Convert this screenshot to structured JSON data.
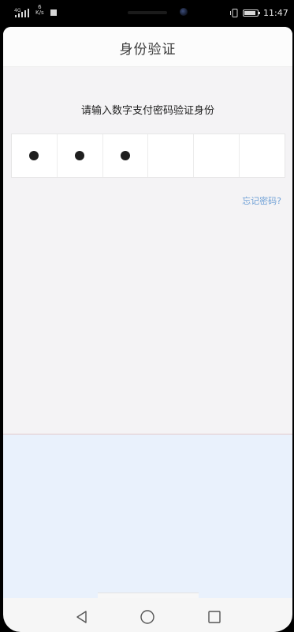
{
  "status_bar": {
    "network_label": "4G",
    "speed_value": "6",
    "speed_unit": "K/s",
    "time": "11:47",
    "battery_percent": 85
  },
  "header": {
    "title": "身份验证"
  },
  "main": {
    "prompt": "请输入数字支付密码验证身份",
    "pin": {
      "length": 6,
      "filled": 3
    },
    "forgot_password_label": "忘记密码?"
  },
  "navigation": {
    "back_icon": "back-triangle-icon",
    "home_icon": "home-circle-icon",
    "recents_icon": "recents-square-icon"
  },
  "colors": {
    "link": "#6fa0d6",
    "keypad_background": "#e9f1fc",
    "page_background": "#f4f3f5"
  }
}
